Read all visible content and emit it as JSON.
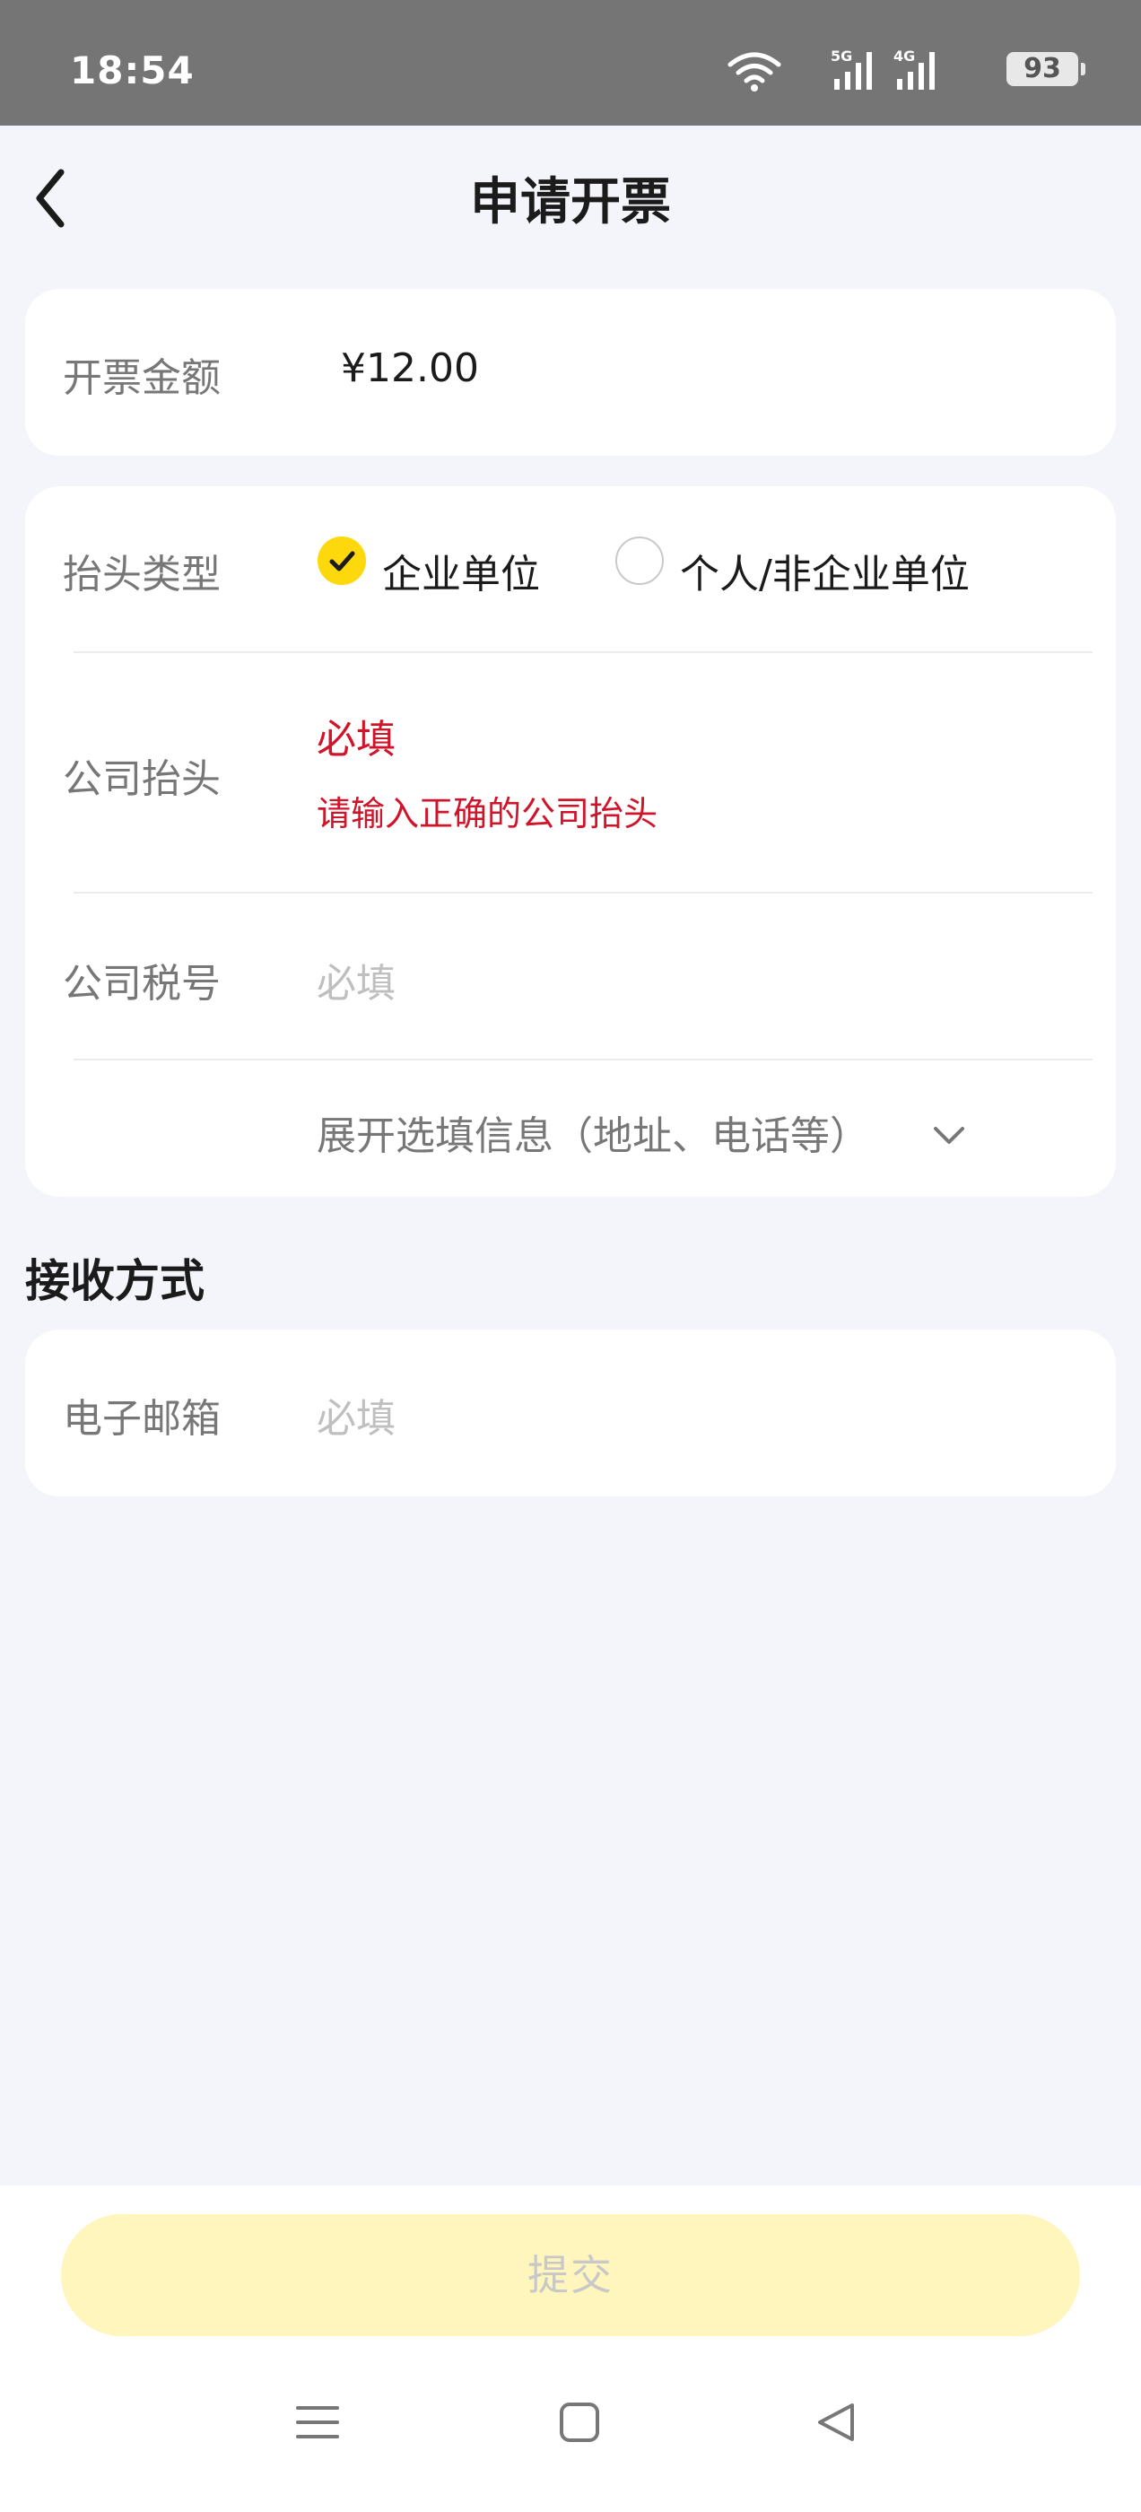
{
  "status_bar": {
    "time": "18:54",
    "battery": "93",
    "icons": [
      "wifi-icon",
      "signal-5g-icon",
      "signal-4g-icon",
      "battery-icon"
    ]
  },
  "header": {
    "title": "申请开票",
    "back_icon": "chevron-left-icon"
  },
  "amount": {
    "label": "开票金额",
    "value": "¥12.00"
  },
  "invoice_form": {
    "title_type": {
      "label": "抬头类型",
      "options": [
        {
          "label": "企业单位",
          "checked": true
        },
        {
          "label": "个人/非企业单位",
          "checked": false
        }
      ]
    },
    "company_title": {
      "label": "公司抬头",
      "placeholder": "必填",
      "error": "请输入正确的公司抬头"
    },
    "tax_number": {
      "label": "公司税号",
      "placeholder": "必填"
    },
    "expand_optional": "展开选填信息（地址、电话等）"
  },
  "receive_section": {
    "title": "接收方式",
    "email": {
      "label": "电子邮箱",
      "placeholder": "必填"
    }
  },
  "footer": {
    "submit_label": "提交"
  },
  "colors": {
    "accent": "#fcd80c",
    "error": "#d0142a",
    "submit_disabled_bg": "#fff6bd",
    "page_bg": "#f3f5fa"
  }
}
